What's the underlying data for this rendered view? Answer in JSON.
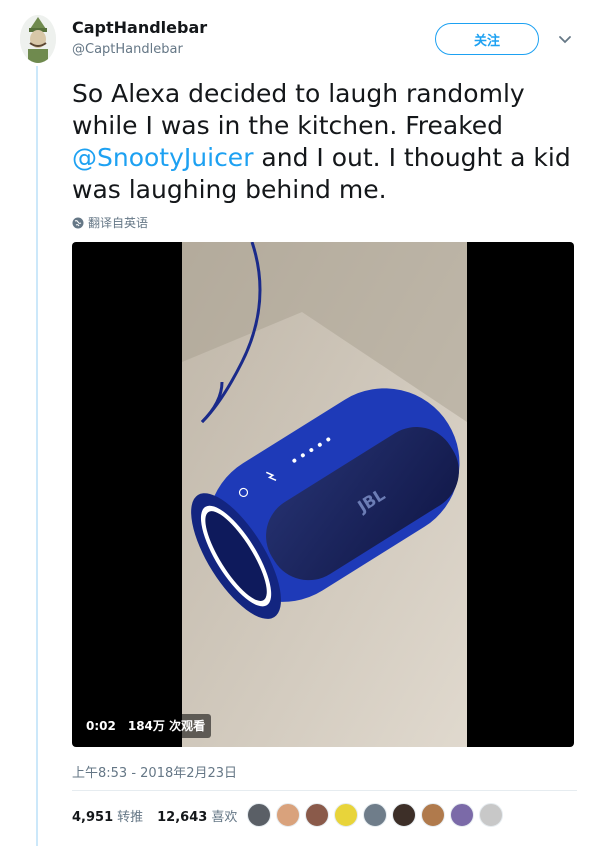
{
  "user": {
    "display_name": "CaptHandlebar",
    "handle": "@CaptHandlebar"
  },
  "follow_button": {
    "label": "关注"
  },
  "more_menu": {
    "icon": "chevron-down-icon"
  },
  "tweet": {
    "text_before": "So Alexa decided to laugh randomly while I was in the kitchen. Freaked ",
    "mention": "@SnootyJuicer",
    "text_after": " and I out. I thought a kid was laughing behind me."
  },
  "translate": {
    "label": "翻译自英语",
    "icon": "globe-icon"
  },
  "video": {
    "duration": "0:02",
    "views": "184万 次观看"
  },
  "timestamp": "上午8:53 - 2018年2月23日",
  "stats": {
    "retweets_count": "4,951",
    "retweets_label": "转推",
    "likes_count": "12,643",
    "likes_label": "喜欢"
  },
  "colors": {
    "accent": "#1da1f2",
    "secondary_text": "#657786",
    "thread_line": "#cce8fa",
    "speaker": "#1e3ab8"
  },
  "likers": [
    {
      "name": "liker-avatar-1",
      "color": "#5a5f66"
    },
    {
      "name": "liker-avatar-2",
      "color": "#d9a27c"
    },
    {
      "name": "liker-avatar-3",
      "color": "#8a5a4a"
    },
    {
      "name": "liker-avatar-4",
      "color": "#e8d43a"
    },
    {
      "name": "liker-avatar-5",
      "color": "#6f7d8a"
    },
    {
      "name": "liker-avatar-6",
      "color": "#3d2f28"
    },
    {
      "name": "liker-avatar-7",
      "color": "#b07a4c"
    },
    {
      "name": "liker-avatar-8",
      "color": "#7b6aa8"
    },
    {
      "name": "liker-avatar-9",
      "color": "#c8c8c8"
    }
  ]
}
